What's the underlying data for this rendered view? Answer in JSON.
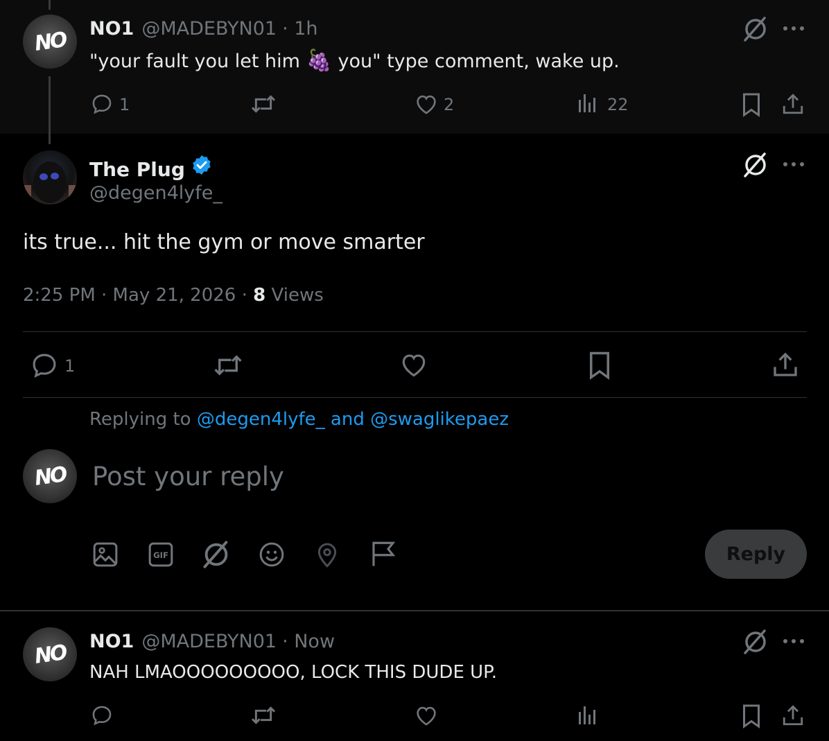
{
  "parent_post": {
    "display_name": "NO1",
    "handle": "@MADEBYN01",
    "time": "· 1h",
    "text_before": "\"your fault you let him ",
    "emoji": "🍇",
    "text_after": " you\" type comment, wake up.",
    "actions": {
      "replies": "1",
      "reposts": "",
      "likes": "2",
      "views": "22"
    }
  },
  "main_post": {
    "display_name": "The Plug",
    "handle": "@degen4lyfe_",
    "text": "its true... hit the gym or move smarter",
    "timestamp": "2:25 PM · May 21, 2026 · ",
    "views_count": "8",
    "views_label": " Views",
    "actions": {
      "replies": "1"
    }
  },
  "composer": {
    "replying_prefix": "Replying to ",
    "replying_mentions": "@degen4lyfe_ and @swaglikepaez",
    "placeholder": "Post your reply",
    "reply_button": "Reply",
    "toolbar_icons": [
      "image-icon",
      "gif-icon",
      "grok-icon",
      "emoji-icon",
      "location-icon",
      "flag-icon"
    ]
  },
  "reply_post": {
    "display_name": "NO1",
    "handle": "@MADEBYN01",
    "time": "· Now",
    "text": "NAH LMAOOOOOOOOO, LOCK THIS DUDE UP."
  },
  "avatar_logo_text": "NO",
  "colors": {
    "background": "#000000",
    "parent_background": "#0c0c0c",
    "text": "#e7e9ea",
    "muted": "#71767b",
    "accent": "#1d9bf0",
    "reply_button": "#3a3b3c"
  }
}
